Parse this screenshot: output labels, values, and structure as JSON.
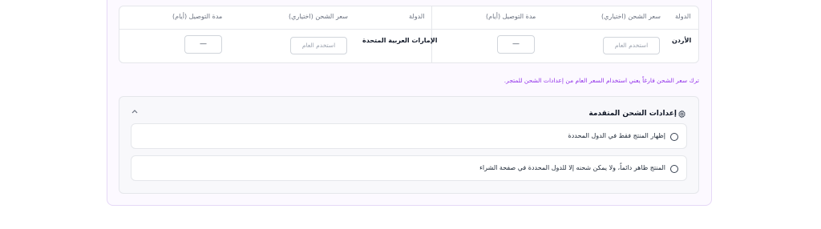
{
  "table": {
    "headers_right": {
      "country": "الدولة",
      "shipping_price": "سعر الشحن (اختياري)",
      "delivery_days": "مدة التوصيل (أيام)"
    },
    "headers_left": {
      "country": "الدولة",
      "shipping_price": "سعر الشحن (اختياري)",
      "delivery_days": "مدة التوصيل (أيام)"
    },
    "rows": [
      {
        "country": "الأردن",
        "price_placeholder": "استخدم العام",
        "days_value": "—"
      },
      {
        "country": "الإمارات العربية المتحدة",
        "price_placeholder": "استخدم العام",
        "days_value": "—"
      }
    ]
  },
  "hint": "ترك سعر الشحن فارغاً يعني استخدام السعر العام من إعدادات الشحن للمتجر.",
  "advanced": {
    "title": "إعدادات الشحن المتقدمة",
    "options": [
      {
        "label": "إظهار المنتج فقط في الدول المحددة"
      },
      {
        "label": "المنتج ظاهر دائماً، ولا يمكن شحنه إلا للدول المحددة في صفحة الشراء"
      }
    ]
  },
  "icons": {
    "settings": "gear-icon",
    "collapse": "chevron-up-icon"
  },
  "colors": {
    "accent": "#9333ea",
    "card_border": "#e6d8f7"
  }
}
